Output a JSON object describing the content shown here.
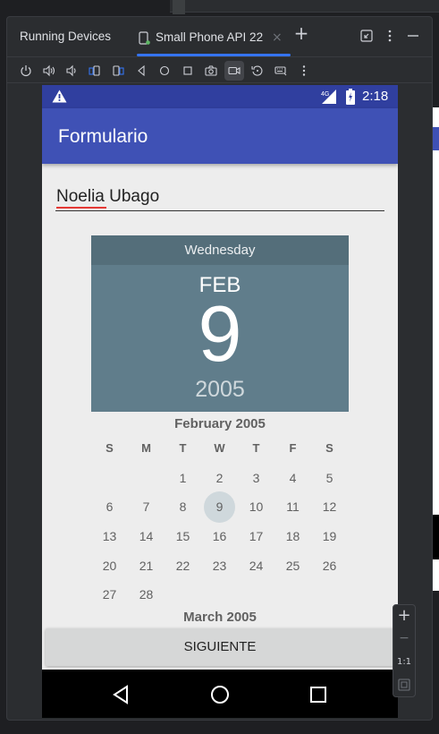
{
  "panel": {
    "title": "Running Devices",
    "tab_label": "Small Phone API 22",
    "add_symbol": "+"
  },
  "toolbar": {
    "icons": [
      "power-icon",
      "volume-up-icon",
      "volume-down-icon",
      "rotate-left-icon",
      "rotate-right-icon",
      "back-icon",
      "home-icon",
      "overview-icon",
      "camera-icon",
      "screen-record-icon",
      "reset-icon",
      "keyboard-icon",
      "more-icon"
    ]
  },
  "device": {
    "status": {
      "time": "2:18",
      "network": "4G"
    },
    "app_bar": {
      "title": "Formulario"
    },
    "name_field": {
      "value": "Noelia Ubago"
    },
    "date_header": {
      "day_of_week": "Wednesday",
      "month": "FEB",
      "day": "9",
      "year": "2005"
    },
    "calendar": {
      "month_title": "February 2005",
      "weekday_headers": [
        "S",
        "M",
        "T",
        "W",
        "T",
        "F",
        "S"
      ],
      "weeks": [
        [
          "",
          "",
          "1",
          "2",
          "3",
          "4",
          "5"
        ],
        [
          "6",
          "7",
          "8",
          "9",
          "10",
          "11",
          "12"
        ],
        [
          "13",
          "14",
          "15",
          "16",
          "17",
          "18",
          "19"
        ],
        [
          "20",
          "21",
          "22",
          "23",
          "24",
          "25",
          "26"
        ],
        [
          "27",
          "28",
          "",
          "",
          "",
          "",
          ""
        ]
      ],
      "selected_day": "9",
      "next_month_title": "March 2005"
    },
    "button": {
      "label": "SIGUIENTE"
    }
  },
  "zoom_panel": {
    "zoom_in": "+",
    "zoom_out": "−",
    "actual_size": "1:1"
  },
  "colors": {
    "status_bar": "#303f9f",
    "app_bar": "#3f51b5",
    "date_header": "#607d8b",
    "date_header_dark": "#546e7a",
    "selected_day": "#cfd8dc",
    "tab_accent": "#3574f0"
  }
}
